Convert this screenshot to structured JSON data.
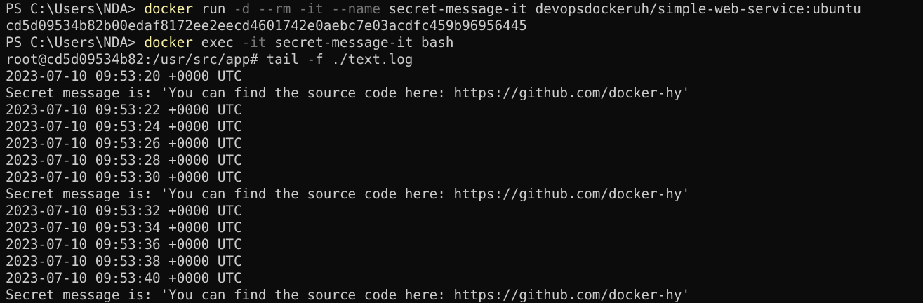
{
  "terminal": {
    "ps_prompt": "PS C:\\Users\\NDA> ",
    "cmd1": {
      "command": "docker",
      "s1": " run ",
      "f1": "-d",
      "s2": " ",
      "f2": "--rm",
      "s3": " ",
      "f3": "-it",
      "s4": " ",
      "f4": "--name",
      "rest": " secret-message-it devopsdockeruh/simple-web-service:ubuntu"
    },
    "container_id": "cd5d09534b82b00edaf8172ee2eecd4601742e0aebc7e03acdfc459b96956445",
    "cmd2": {
      "command": "docker",
      "s1": " exec ",
      "f1": "-it",
      "rest": " secret-message-it bash"
    },
    "bash_line": "root@cd5d09534b82:/usr/src/app# tail -f ./text.log",
    "log": [
      "2023-07-10 09:53:20 +0000 UTC",
      "Secret message is: 'You can find the source code here: https://github.com/docker-hy'",
      "2023-07-10 09:53:22 +0000 UTC",
      "2023-07-10 09:53:24 +0000 UTC",
      "2023-07-10 09:53:26 +0000 UTC",
      "2023-07-10 09:53:28 +0000 UTC",
      "2023-07-10 09:53:30 +0000 UTC",
      "Secret message is: 'You can find the source code here: https://github.com/docker-hy'",
      "2023-07-10 09:53:32 +0000 UTC",
      "2023-07-10 09:53:34 +0000 UTC",
      "2023-07-10 09:53:36 +0000 UTC",
      "2023-07-10 09:53:38 +0000 UTC",
      "2023-07-10 09:53:40 +0000 UTC",
      "Secret message is: 'You can find the source code here: https://github.com/docker-hy'"
    ],
    "colors": {
      "background": "#0c0c0c",
      "text": "#cccccc",
      "command": "#f9f1a5",
      "flag": "#767676"
    }
  }
}
